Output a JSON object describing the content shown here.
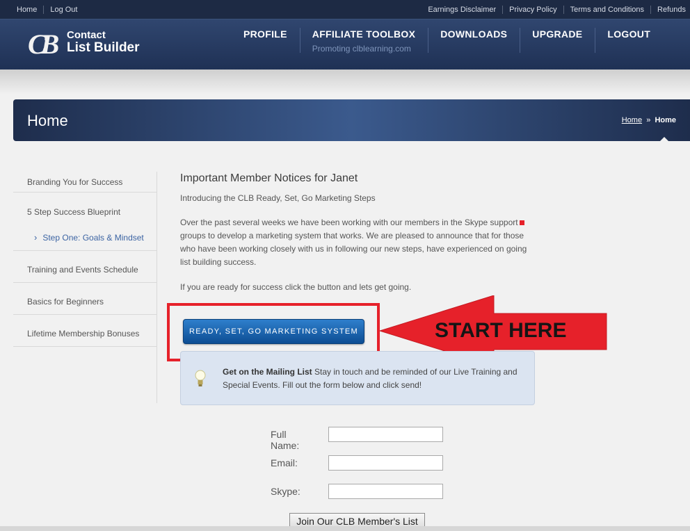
{
  "topbar": {
    "left": [
      "Home",
      "Log Out"
    ],
    "right": [
      "Earnings Disclaimer",
      "Privacy Policy",
      "Terms and Conditions",
      "Refunds"
    ]
  },
  "logo": {
    "line1": "Contact",
    "line2": "List Builder",
    "mark": "CB"
  },
  "nav": [
    {
      "label": "PROFILE"
    },
    {
      "label": "AFFILIATE TOOLBOX",
      "sub": "Promoting clblearning.com"
    },
    {
      "label": "DOWNLOADS"
    },
    {
      "label": "UPGRADE"
    },
    {
      "label": "LOGOUT"
    }
  ],
  "banner": {
    "title": "Home",
    "crumb_link": "Home",
    "crumb_sep": "»",
    "crumb_current": "Home"
  },
  "sidebar": {
    "items": [
      "Branding You for Success",
      "5 Step Success Blueprint"
    ],
    "sub_item": "Step One: Goals & Mindset",
    "items2": [
      "Training and Events Schedule",
      "Basics for Beginners",
      "Lifetime Membership Bonuses"
    ]
  },
  "main": {
    "heading": "Important Member Notices for Janet",
    "intro": "Introducing the CLB Ready, Set, Go Marketing Steps",
    "para": "Over the past several weeks we have been working with our members in the Skype support groups to develop a marketing system that works. We are pleased to announce that for those who have been working closely with us in following our new steps, have experienced on going list building success.",
    "ready": "If you are ready for success click the button and lets get going.",
    "button": "READY, SET, GO MARKETING SYSTEM",
    "callout": "START HERE"
  },
  "notice": {
    "bold": "Get on the Mailing List",
    "text": " Stay in touch and be reminded of our Live Training and Special Events. Fill out the form below and click send!"
  },
  "form": {
    "fields": [
      {
        "label": "Full Name:",
        "value": ""
      },
      {
        "label": "Email:",
        "value": ""
      },
      {
        "label": "Skype:",
        "value": ""
      }
    ],
    "submit": "Join Our CLB Member's List"
  },
  "colors": {
    "accent_red": "#e6212a",
    "nav_bg": "#1f3155",
    "button_blue": "#0d4d93"
  }
}
